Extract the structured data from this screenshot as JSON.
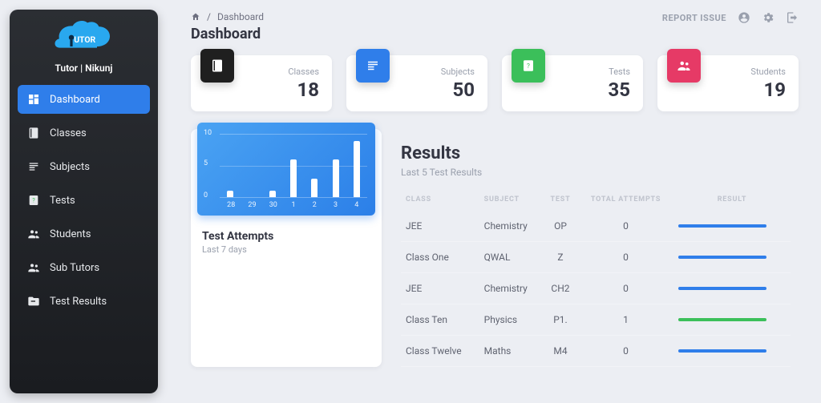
{
  "brand": "Tutor | Nikunj",
  "breadcrumb": {
    "current": "Dashboard"
  },
  "page_title": "Dashboard",
  "topbar": {
    "report": "REPORT ISSUE"
  },
  "nav": [
    {
      "label": "Dashboard",
      "icon": "dashboard",
      "active": true
    },
    {
      "label": "Classes",
      "icon": "book",
      "active": false
    },
    {
      "label": "Subjects",
      "icon": "subject",
      "active": false
    },
    {
      "label": "Tests",
      "icon": "quiz",
      "active": false
    },
    {
      "label": "Students",
      "icon": "group",
      "active": false
    },
    {
      "label": "Sub Tutors",
      "icon": "group",
      "active": false
    },
    {
      "label": "Test Results",
      "icon": "folder",
      "active": false
    }
  ],
  "stats": [
    {
      "label": "Classes",
      "value": "18",
      "tile": "black",
      "icon": "book"
    },
    {
      "label": "Subjects",
      "value": "50",
      "tile": "blue",
      "icon": "subject"
    },
    {
      "label": "Tests",
      "value": "35",
      "tile": "green",
      "icon": "quiz"
    },
    {
      "label": "Students",
      "value": "19",
      "tile": "pink",
      "icon": "group"
    }
  ],
  "chart_card": {
    "title": "Test Attempts",
    "subtitle": "Last 7 days"
  },
  "chart_data": {
    "type": "bar",
    "categories": [
      "28",
      "29",
      "30",
      "1",
      "2",
      "3",
      "4"
    ],
    "values": [
      1,
      0,
      1,
      6,
      3,
      6,
      9
    ],
    "ylim": [
      0,
      10
    ],
    "yticks": [
      0,
      5,
      10
    ],
    "title": "Test Attempts",
    "xlabel": "",
    "ylabel": ""
  },
  "results": {
    "title": "Results",
    "subtitle": "Last 5 Test Results",
    "columns": [
      "CLASS",
      "SUBJECT",
      "TEST",
      "TOTAL ATTEMPTS",
      "RESULT"
    ],
    "rows": [
      {
        "class": "JEE",
        "subject": "Chemistry",
        "test": "OP",
        "attempts": "0",
        "bar": "blue"
      },
      {
        "class": "Class One",
        "subject": "QWAL",
        "test": "Z",
        "attempts": "0",
        "bar": "blue"
      },
      {
        "class": "JEE",
        "subject": "Chemistry",
        "test": "CH2",
        "attempts": "0",
        "bar": "blue"
      },
      {
        "class": "Class Ten",
        "subject": "Physics",
        "test": "P1.",
        "attempts": "1",
        "bar": "green"
      },
      {
        "class": "Class Twelve",
        "subject": "Maths",
        "test": "M4",
        "attempts": "0",
        "bar": "blue"
      }
    ]
  }
}
